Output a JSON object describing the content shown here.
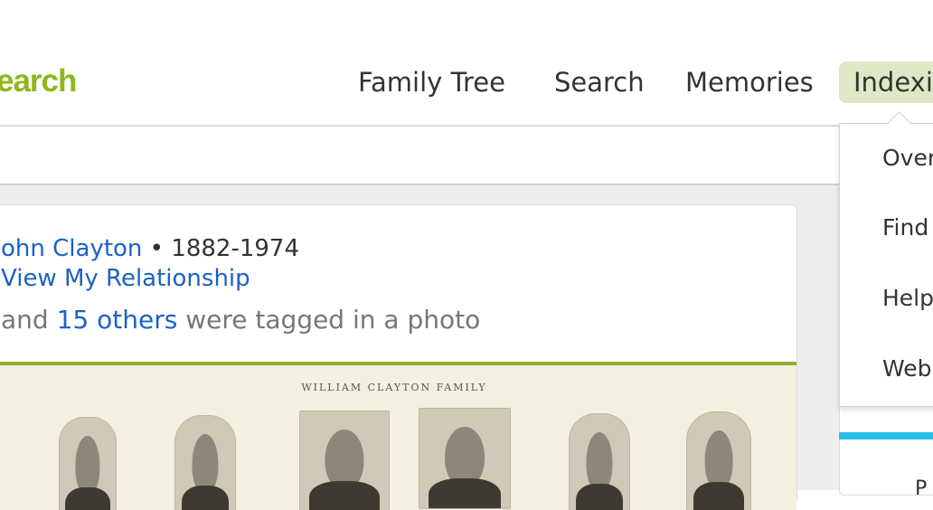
{
  "header": {
    "logo_text": "earch",
    "nav": [
      {
        "label": "Family Tree"
      },
      {
        "label": "Search"
      },
      {
        "label": "Memories"
      },
      {
        "label": "Indexi"
      }
    ]
  },
  "dropdown": {
    "items": [
      {
        "label": "Over"
      },
      {
        "label": "Find"
      },
      {
        "label": "Help"
      },
      {
        "label": "Web"
      }
    ]
  },
  "feed": {
    "person_name": "ohn Clayton",
    "separator": "•",
    "lifespan": "1882-1974",
    "relationship_link": "View My Relationship",
    "tag_prefix": "and",
    "tag_others": "15 others",
    "tag_suffix": "were tagged in a photo",
    "photo_caption": "WILLIAM CLAYTON FAMILY"
  },
  "right_panel": {
    "letter": "P"
  },
  "colors": {
    "brand_green": "#8cb81c",
    "active_nav_bg": "#dfe8c6",
    "link_blue": "#1b61c7",
    "rule_green": "#88b02b",
    "accent_blue": "#27c0ea"
  }
}
